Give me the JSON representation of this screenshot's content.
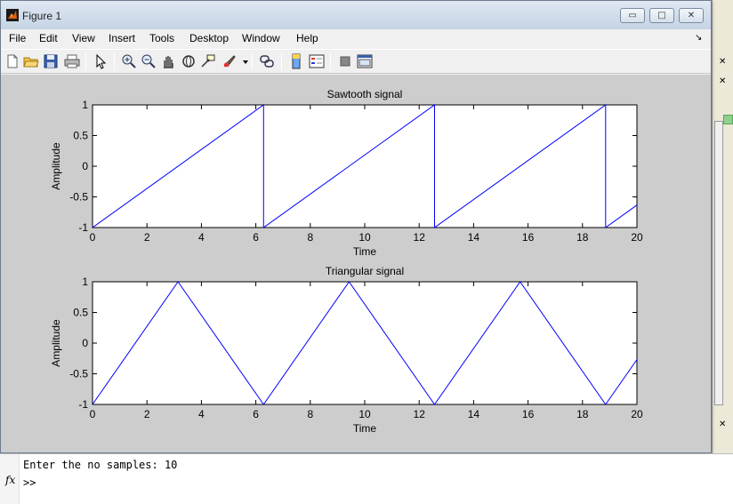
{
  "window": {
    "title": "Figure 1",
    "minimize": "▭",
    "maximize": "□",
    "close": "✕"
  },
  "menu": {
    "items": [
      "File",
      "Edit",
      "View",
      "Insert",
      "Tools",
      "Desktop",
      "Window",
      "Help"
    ],
    "dock": "↘"
  },
  "toolbar": {
    "icons": [
      "new-figure-icon",
      "open-file-icon",
      "save-icon",
      "print-icon",
      "pointer-icon",
      "zoom-in-icon",
      "zoom-out-icon",
      "pan-icon",
      "rotate-3d-icon",
      "data-cursor-icon",
      "brush-icon",
      "link-plot-icon",
      "colorbar-icon",
      "legend-icon",
      "hide-plot-tools-icon",
      "show-plot-tools-icon"
    ]
  },
  "background": {
    "close_glyph": "✕"
  },
  "command_window": {
    "output_line": "Enter the no samples: 10",
    "fx_label": "fx",
    "prompt": ">>"
  },
  "colors": {
    "line": "#0000ff",
    "figure_bg": "#cdcdcd",
    "axes_bg": "#ffffff"
  },
  "chart_data": [
    {
      "type": "line",
      "title": "Sawtooth signal",
      "xlabel": "Time",
      "ylabel": "Amplitude",
      "xlim": [
        0,
        20
      ],
      "ylim": [
        -1,
        1
      ],
      "xticks": [
        "0",
        "2",
        "4",
        "6",
        "8",
        "10",
        "12",
        "14",
        "16",
        "18",
        "20"
      ],
      "yticks": [
        "-1",
        "-0.5",
        "0",
        "0.5",
        "1"
      ],
      "grid": false,
      "series": [
        {
          "x": [
            0,
            6.283,
            6.283,
            12.566,
            12.566,
            18.85,
            18.85,
            20
          ],
          "y": [
            -1,
            1,
            -1,
            1,
            -1,
            1,
            -1,
            -0.634
          ]
        }
      ]
    },
    {
      "type": "line",
      "title": "Triangular signal",
      "xlabel": "Time",
      "ylabel": "Amplitude",
      "xlim": [
        0,
        20
      ],
      "ylim": [
        -1,
        1
      ],
      "xticks": [
        "0",
        "2",
        "4",
        "6",
        "8",
        "10",
        "12",
        "14",
        "16",
        "18",
        "20"
      ],
      "yticks": [
        "-1",
        "-0.5",
        "0",
        "0.5",
        "1"
      ],
      "grid": false,
      "series": [
        {
          "x": [
            0,
            3.142,
            6.283,
            9.425,
            12.566,
            15.708,
            18.85,
            20
          ],
          "y": [
            -1,
            1,
            -1,
            1,
            -1,
            1,
            -1,
            -0.268
          ]
        }
      ]
    }
  ]
}
